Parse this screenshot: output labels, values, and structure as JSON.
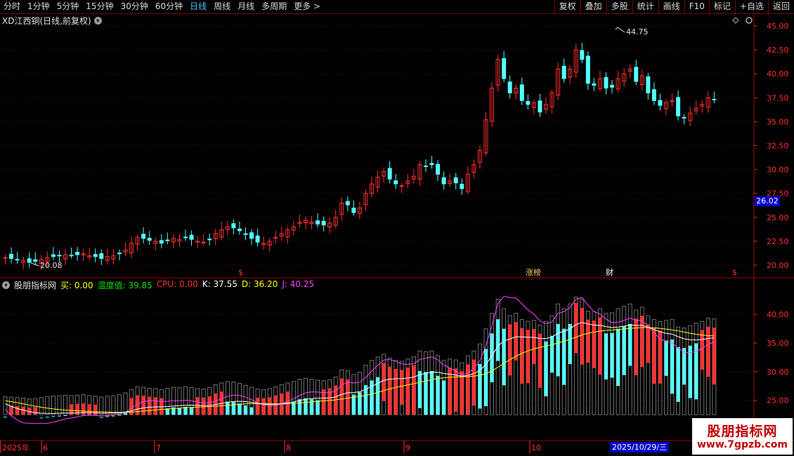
{
  "toolbar": {
    "left": [
      "分时",
      "1分钟",
      "5分钟",
      "15分钟",
      "30分钟",
      "60分钟",
      "日线",
      "周线",
      "月线",
      "多周期",
      "更多 >"
    ],
    "active": "日线",
    "right": [
      "复权",
      "叠加",
      "多股",
      "统计",
      "画线",
      "F10",
      "标记",
      "+自选",
      "返回"
    ]
  },
  "chart": {
    "title": "XD江西铜(日线,前复权)",
    "title_icon": "chevron-down-icon",
    "corner_icons": [
      "diamond-icon",
      "gear-icon"
    ],
    "y_ticks": [
      "45.00",
      "42.50",
      "40.00",
      "37.50",
      "35.00",
      "32.50",
      "30.00",
      "27.50",
      "25.00",
      "22.50",
      "20.00"
    ],
    "high_label": "44.75",
    "low_label": "20.08",
    "current_price": "26.02",
    "markers": [
      {
        "text": "$",
        "color": "#ff3030"
      },
      {
        "text": "涨榜",
        "color": "#ffcc66"
      },
      {
        "text": "财",
        "color": "#ffffff"
      },
      {
        "text": "$",
        "color": "#ff3030"
      }
    ]
  },
  "indicator": {
    "name": "股朋指标网",
    "items": [
      {
        "label": "买: 0.00",
        "color": "#ffff00"
      },
      {
        "label": "温度值: 39.85",
        "color": "#00e000"
      },
      {
        "label": "CPU: 0.00",
        "color": "#ff3030"
      },
      {
        "label": "K: 37.55",
        "color": "#ffffff"
      },
      {
        "label": "D: 36.20",
        "color": "#ffff00"
      },
      {
        "label": "J: 40.25",
        "color": "#ff40ff"
      }
    ],
    "y_ticks": [
      "40.00",
      "35.00",
      "30.00",
      "25.00"
    ]
  },
  "x_axis": {
    "labels": [
      "2025年",
      "6",
      "7",
      "8",
      "9",
      "10"
    ],
    "selected_date": "2025/10/29/三"
  },
  "watermark": {
    "title": "股朋指标网",
    "url": "www.7gpzb.com"
  },
  "colors": {
    "up": "#ff3030",
    "down": "#54ffff",
    "grid": "#5a0000",
    "axis": "#a00000",
    "tick": "#ff3030"
  }
}
